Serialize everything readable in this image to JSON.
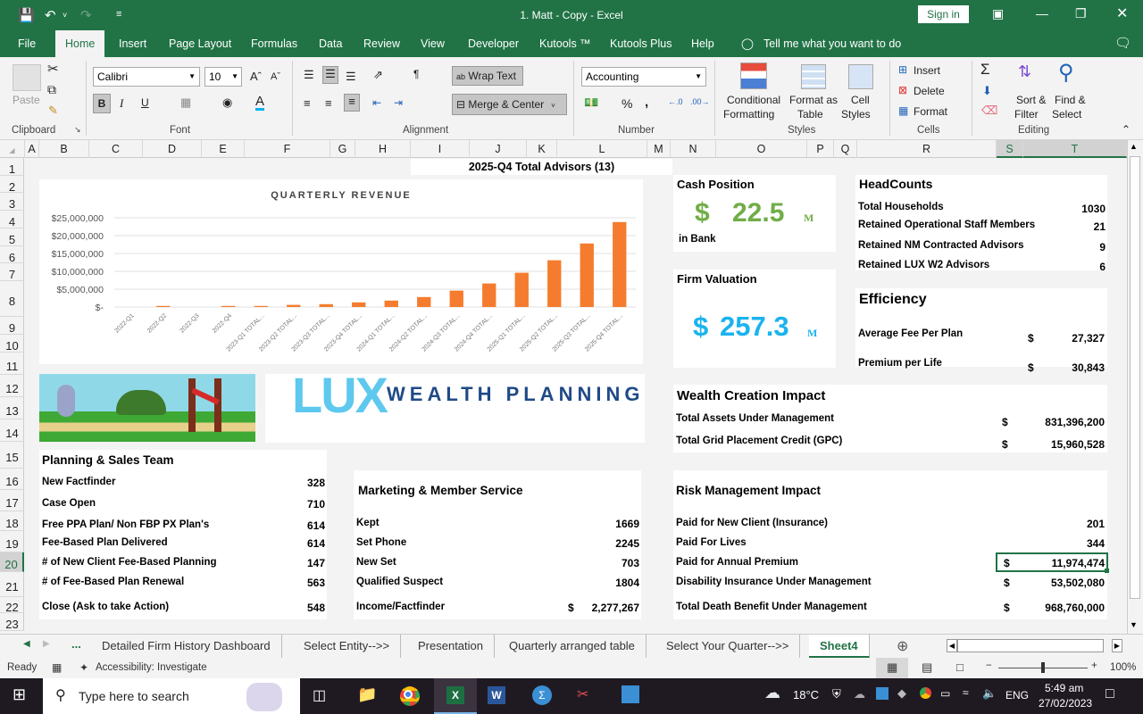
{
  "window": {
    "title": "1. Matt - Copy  -  Excel",
    "sign_in": "Sign in"
  },
  "ribbon_tabs": [
    "File",
    "Home",
    "Insert",
    "Page Layout",
    "Formulas",
    "Data",
    "Review",
    "View",
    "Developer",
    "Kutools ™",
    "Kutools Plus",
    "Help"
  ],
  "active_tab": "Home",
  "tell_me": "Tell me what you want to do",
  "ribbon": {
    "clipboard": {
      "paste": "Paste",
      "label": "Clipboard"
    },
    "font": {
      "name": "Calibri",
      "size": "10",
      "label": "Font",
      "bold": "B",
      "italic": "I",
      "underline": "U"
    },
    "alignment": {
      "wrap_text": "Wrap Text",
      "merge_center": "Merge & Center",
      "label": "Alignment"
    },
    "number": {
      "format": "Accounting",
      "label": "Number",
      "percent": "%",
      "comma": ","
    },
    "styles": {
      "conditional": "Conditional",
      "conditional2": "Formatting",
      "format_as": "Format as",
      "format_as2": "Table",
      "cell": "Cell",
      "cell2": "Styles",
      "label": "Styles"
    },
    "cells": {
      "insert": "Insert",
      "delete": "Delete",
      "format": "Format",
      "label": "Cells"
    },
    "editing": {
      "sort": "Sort &",
      "sort2": "Filter",
      "find": "Find &",
      "find2": "Select",
      "label": "Editing"
    }
  },
  "columns": [
    "A",
    "B",
    "C",
    "D",
    "E",
    "F",
    "G",
    "H",
    "I",
    "J",
    "K",
    "L",
    "M",
    "N",
    "O",
    "P",
    "Q",
    "R",
    "S",
    "T"
  ],
  "rows": [
    "1",
    "2",
    "3",
    "4",
    "5",
    "6",
    "7",
    "8",
    "9",
    "10",
    "11",
    "12",
    "13",
    "14",
    "15",
    "16",
    "17",
    "18",
    "19",
    "20",
    "21",
    "22",
    "23"
  ],
  "header_title": "2025-Q4 Total Advisors  (13)",
  "chart_data": {
    "type": "bar",
    "title": "QUARTERLY REVENUE",
    "categories": [
      "2022-Q1",
      "2022-Q2",
      "2022-Q3",
      "2022-Q4",
      "2023-Q1 TOTAL...",
      "2023-Q2 TOTAL...",
      "2023-Q3 TOTAL...",
      "2023-Q4 TOTAL...",
      "2024-Q1 TOTAL...",
      "2024-Q2 TOTAL...",
      "2024-Q3 TOTAL...",
      "2024-Q4 TOTAL...",
      "2025-Q1 TOTAL...",
      "2025-Q2 TOTAL...",
      "2025-Q3 TOTAL...",
      "2025-Q4 TOTAL..."
    ],
    "values": [
      0,
      300000,
      0,
      300000,
      300000,
      600000,
      800000,
      1300000,
      1800000,
      2800000,
      4600000,
      6600000,
      9600000,
      13100000,
      17800000,
      23800000
    ],
    "ylim": [
      0,
      25000000
    ],
    "yticks": [
      "$-",
      "$5,000,000",
      "$10,000,000",
      "$15,000,000",
      "$20,000,000",
      "$25,000,000"
    ],
    "xlabel": "",
    "ylabel": "",
    "grid": true,
    "color": "#f57c2e"
  },
  "cash": {
    "title": "Cash Position",
    "currency": "$",
    "value": "22.5",
    "unit": "M",
    "note": "in Bank",
    "color": "#70ad47"
  },
  "valuation": {
    "title": "Firm Valuation",
    "currency": "$",
    "value": "257.3",
    "unit": "M",
    "color": "#1ab3ef"
  },
  "headcounts": {
    "title": "HeadCounts",
    "items": [
      {
        "label": "Total Households",
        "value": "1030"
      },
      {
        "label": "Retained Operational Staff Members",
        "value": "21"
      },
      {
        "label": "Retained NM Contracted Advisors",
        "value": "9"
      },
      {
        "label": "Retained LUX W2 Advisors",
        "value": "6"
      }
    ]
  },
  "efficiency": {
    "title": "Efficiency",
    "items": [
      {
        "label": "Average Fee Per Plan",
        "cur": "$",
        "value": "27,327"
      },
      {
        "label": "Premium per Life",
        "cur": "$",
        "value": "30,843"
      }
    ]
  },
  "logo": {
    "lux": "LUX",
    "tagline": "WEALTH PLANNING"
  },
  "wealth": {
    "title": "Wealth Creation Impact",
    "items": [
      {
        "label": "Total Assets Under Management",
        "cur": "$",
        "value": "831,396,200"
      },
      {
        "label": "Total Grid Placement Credit (GPC)",
        "cur": "$",
        "value": "15,960,528"
      }
    ]
  },
  "planning": {
    "title": "Planning & Sales Team",
    "items": [
      {
        "label": "New Factfinder",
        "value": "328"
      },
      {
        "label": "Case Open",
        "value": "710"
      },
      {
        "label": "Free PPA Plan/ Non FBP PX Plan's",
        "value": "614"
      },
      {
        "label": "Fee-Based Plan Delivered",
        "value": "614"
      },
      {
        "label": "# of New Client Fee-Based Planning",
        "value": "147"
      },
      {
        "label": "# of Fee-Based Plan Renewal",
        "value": "563"
      },
      {
        "label": "Close (Ask to take Action)",
        "value": "548"
      }
    ]
  },
  "marketing": {
    "title": "Marketing & Member Service",
    "items": [
      {
        "label": "Kept",
        "cur": "",
        "value": "1669"
      },
      {
        "label": "Set Phone",
        "cur": "",
        "value": "2245"
      },
      {
        "label": "New Set",
        "cur": "",
        "value": "703"
      },
      {
        "label": "Qualified Suspect",
        "cur": "",
        "value": "1804"
      },
      {
        "label": "Income/Factfinder",
        "cur": "$",
        "value": "2,277,267"
      }
    ]
  },
  "risk": {
    "title": "Risk Management Impact",
    "items": [
      {
        "label": "Paid for New Client (Insurance)",
        "cur": "",
        "value": "201"
      },
      {
        "label": "Paid For Lives",
        "cur": "",
        "value": "344"
      },
      {
        "label": "Paid for Annual Premium",
        "cur": "$",
        "value": "11,974,474"
      },
      {
        "label": "Disability Insurance Under Management",
        "cur": "$",
        "value": "53,502,080"
      },
      {
        "label": "Total Death Benefit Under Management",
        "cur": "$",
        "value": "968,760,000"
      }
    ]
  },
  "sheet_tabs": [
    "Detailed Firm History Dashboard",
    "Select Entity-->>",
    "Presentation",
    "Quarterly arranged table",
    "Select Your Quarter-->>",
    "Sheet4"
  ],
  "active_sheet": "Sheet4",
  "status": {
    "ready": "Ready",
    "accessibility": "Accessibility: Investigate",
    "zoom": "100%",
    "zoom_fraction": 0.5
  },
  "taskbar": {
    "search_placeholder": "Type here to search",
    "temp": "18°C",
    "lang": "ENG",
    "time": "5:49 am",
    "date": "27/02/2023"
  }
}
